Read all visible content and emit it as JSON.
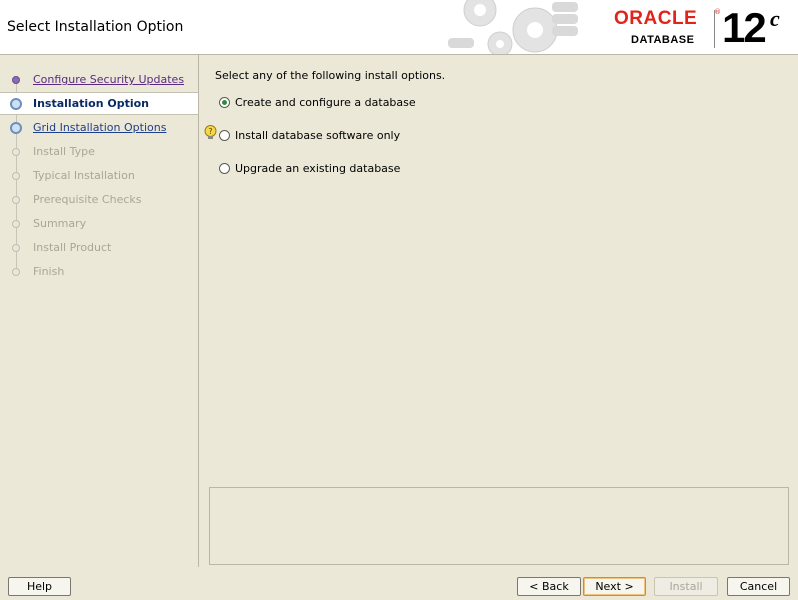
{
  "header": {
    "title": "Select Installation Option",
    "brand": "ORACLE",
    "brand_sub": "DATABASE",
    "version": "12",
    "version_sup": "c"
  },
  "steps": [
    {
      "label": "Configure Security Updates",
      "state": "done"
    },
    {
      "label": "Installation Option",
      "state": "current"
    },
    {
      "label": "Grid Installation Options",
      "state": "link"
    },
    {
      "label": "Install Type",
      "state": "pending"
    },
    {
      "label": "Typical Installation",
      "state": "pending"
    },
    {
      "label": "Prerequisite Checks",
      "state": "pending"
    },
    {
      "label": "Summary",
      "state": "pending"
    },
    {
      "label": "Install Product",
      "state": "pending"
    },
    {
      "label": "Finish",
      "state": "pending"
    }
  ],
  "main": {
    "intro": "Select any of the following install options.",
    "options": [
      {
        "label": "Create and configure a database",
        "checked": true
      },
      {
        "label": "Install database software only",
        "checked": false
      },
      {
        "label": "Upgrade an existing database",
        "checked": false
      }
    ]
  },
  "footer": {
    "help": "Help",
    "back": "< Back",
    "next": "Next >",
    "install": "Install",
    "cancel": "Cancel"
  }
}
